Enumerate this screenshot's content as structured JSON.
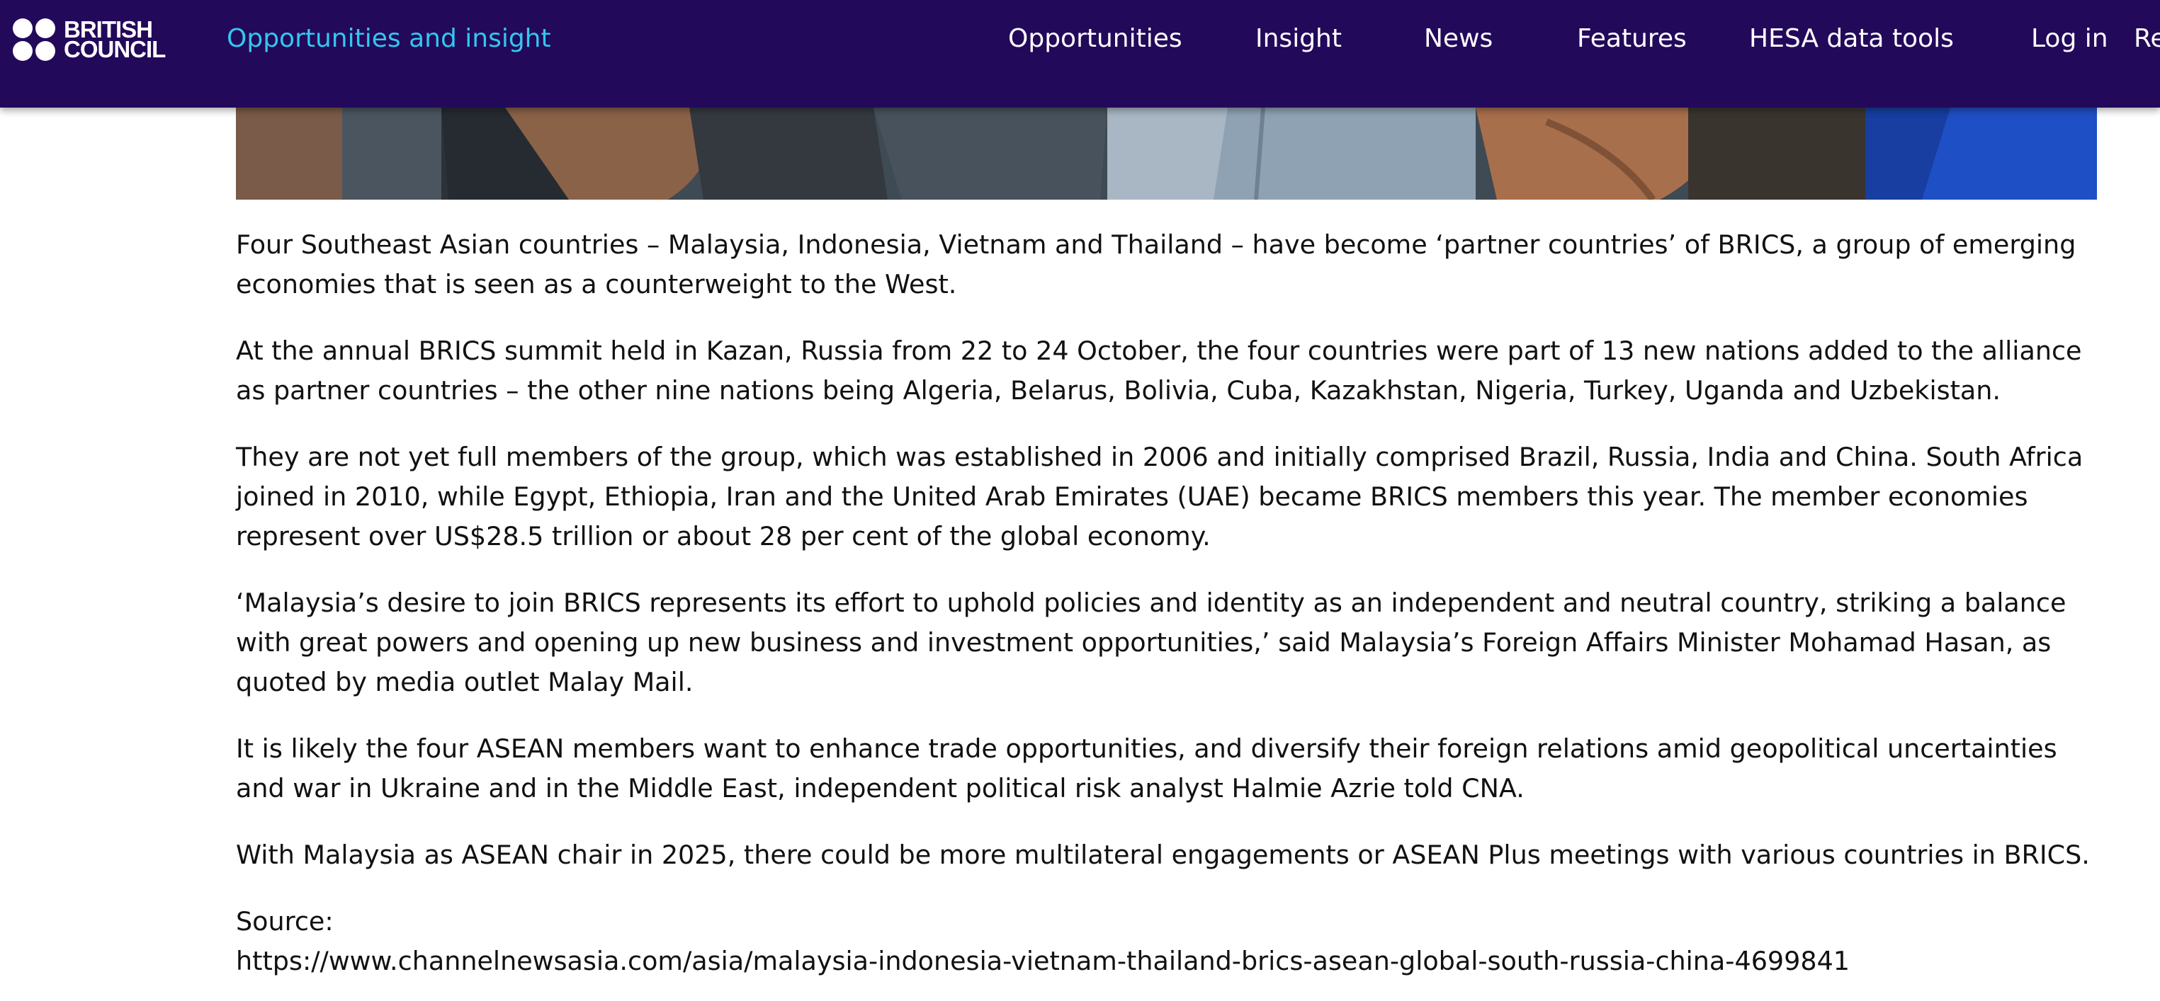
{
  "header": {
    "logo_line1": "BRITISH",
    "logo_line2": "COUNCIL",
    "site_title": "Opportunities and insight",
    "nav": [
      "Opportunities",
      "Insight",
      "News",
      "Features",
      "HESA data tools",
      "Log in",
      "Re"
    ]
  },
  "hero": {
    "description": ""
  },
  "article": {
    "paragraphs": [
      "Four Southeast Asian countries – Malaysia, Indonesia, Vietnam and Thailand – have become ‘partner countries’ of BRICS, a group of emerging economies that is seen as a counterweight to the West.",
      "At the annual BRICS summit held in Kazan, Russia from 22 to 24 October, the four countries were part of 13 new nations added to the alliance as partner countries – the other nine nations being Algeria, Belarus, Bolivia, Cuba, Kazakhstan, Nigeria, Turkey, Uganda and Uzbekistan.",
      "They are not yet full members of the group, which was established in 2006 and initially comprised Brazil, Russia, India and China. South Africa joined in 2010, while Egypt, Ethiopia, Iran and the United Arab Emirates (UAE) became BRICS members this year. The member economies represent over US$28.5 trillion or about 28 per cent of the global economy.",
      "‘Malaysia’s desire to join BRICS represents its effort to uphold policies and identity as an independent and neutral country, striking a balance with great powers and opening up new business and investment opportunities,’ said Malaysia’s Foreign Affairs Minister Mohamad Hasan, as quoted by media outlet Malay Mail.",
      "It is likely the four ASEAN members want to enhance trade opportunities, and diversify their foreign relations amid geopolitical uncertainties and war in Ukraine and in the Middle East, independent political risk analyst Halmie Azrie told CNA.",
      "With Malaysia as ASEAN chair in 2025, there could be more multilateral engagements or ASEAN Plus meetings with various countries in BRICS."
    ],
    "source_label": "Source:",
    "source_url": "https://www.channelnewsasia.com/asia/malaysia-indonesia-vietnam-thailand-brics-asean-global-south-russia-china-4699841"
  },
  "colors": {
    "header_bg": "#23095a",
    "site_title": "#33c7ef",
    "nav_text": "#ffffff",
    "body_text": "#111111"
  }
}
